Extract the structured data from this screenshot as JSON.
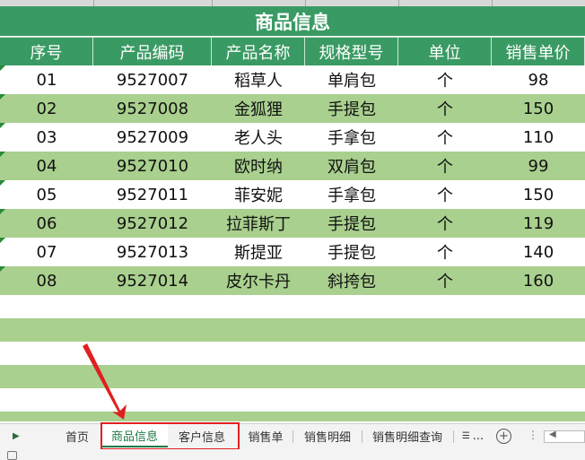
{
  "sheet": {
    "title": "商品信息",
    "headers": [
      "序号",
      "产品编码",
      "产品名称",
      "规格型号",
      "单位",
      "销售单价"
    ],
    "rows": [
      [
        "01",
        "9527007",
        "稻草人",
        "单肩包",
        "个",
        "98"
      ],
      [
        "02",
        "9527008",
        "金狐狸",
        "手提包",
        "个",
        "150"
      ],
      [
        "03",
        "9527009",
        "老人头",
        "手拿包",
        "个",
        "110"
      ],
      [
        "04",
        "9527010",
        "欧时纳",
        "双肩包",
        "个",
        "99"
      ],
      [
        "05",
        "9527011",
        "菲安妮",
        "手拿包",
        "个",
        "150"
      ],
      [
        "06",
        "9527012",
        "拉菲斯丁",
        "手提包",
        "个",
        "119"
      ],
      [
        "07",
        "9527013",
        "斯提亚",
        "手提包",
        "个",
        "140"
      ],
      [
        "08",
        "9527014",
        "皮尔卡丹",
        "斜挎包",
        "个",
        "160"
      ]
    ]
  },
  "tabs": [
    {
      "label": "首页",
      "active": false
    },
    {
      "label": "商品信息",
      "active": true
    },
    {
      "label": "客户信息",
      "active": false
    },
    {
      "label": "销售单",
      "active": false
    },
    {
      "label": "销售明细",
      "active": false
    },
    {
      "label": "销售明细查询",
      "active": false
    },
    {
      "label": "...",
      "active": false
    }
  ],
  "colors": {
    "header_green": "#3a9a63",
    "band_green": "#a9d08e",
    "active_tab_text": "#1e7a45",
    "annotation_red": "#e02020"
  },
  "icons": {
    "tab_nav": "triangle-right",
    "add_sheet": "plus-circle",
    "more": "vertical-dots",
    "sheet_menu": "stacked-lines",
    "status": "macro-record"
  }
}
